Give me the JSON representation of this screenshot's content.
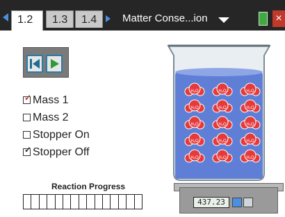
{
  "tabs": [
    {
      "label": "1.2",
      "active": true
    },
    {
      "label": "1.3",
      "active": false
    },
    {
      "label": "1.4",
      "active": false
    }
  ],
  "document_title": "Matter Conse...ion",
  "icons": {
    "prev_page": "triangle-left-icon",
    "next_page": "triangle-right-icon",
    "menu": "chevron-down-icon",
    "battery": "battery-icon",
    "close": "close-icon",
    "restart": "skip-to-start-icon",
    "play": "play-icon"
  },
  "options": [
    {
      "label": "Mass 1",
      "checked": true
    },
    {
      "label": "Mass 2",
      "checked": false
    },
    {
      "label": "Stopper On",
      "checked": false
    },
    {
      "label": "Stopper Off",
      "checked": true
    }
  ],
  "check_mark": "✓",
  "progress": {
    "label": "Reaction Progress",
    "segments": 15,
    "filled": 0
  },
  "molecule_label": "H₂O",
  "molecules": {
    "rows": 5,
    "cols": 3
  },
  "scale_reading": "437.23",
  "colors": {
    "tab_active": "#ffffff",
    "tab_inactive": "#c9c9c9",
    "topbar": "#262626",
    "nav_arrow": "#4a90e2",
    "water": "#5f7fd6",
    "molecule": "#e63a3a",
    "play_icon": "#2f9a3d",
    "restart_icon": "#1f6d93"
  }
}
